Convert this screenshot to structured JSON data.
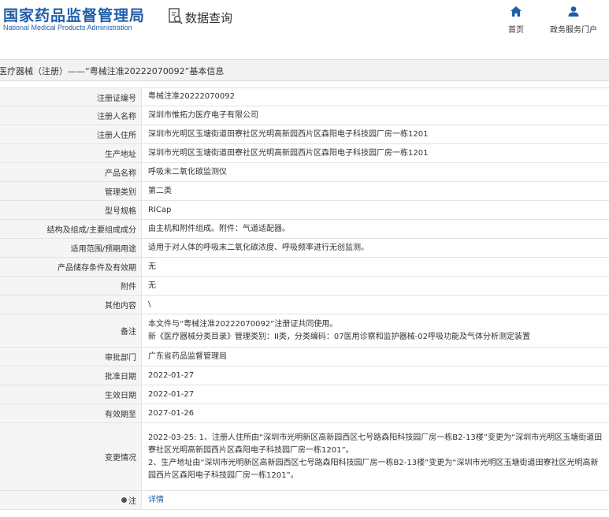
{
  "header": {
    "logo_cn": "国家药品监督管理局",
    "logo_en": "National Medical Products Administration",
    "query_label": "数据查询",
    "nav": {
      "home": "首页",
      "portal": "政务服务门户"
    }
  },
  "title": "医疗器械（注册）——“粤械注准20222070092”基本信息",
  "rows": [
    {
      "label": "注册证编号",
      "value": "粤械注准20222070092"
    },
    {
      "label": "注册人名称",
      "value": "深圳市惟拓力医疗电子有限公司"
    },
    {
      "label": "注册人住所",
      "value": "深圳市光明区玉塘街道田寮社区光明高新园西片区森阳电子科技园厂房一栋1201"
    },
    {
      "label": "生产地址",
      "value": "深圳市光明区玉塘街道田寮社区光明高新园西片区森阳电子科技园厂房一栋1201"
    },
    {
      "label": "产品名称",
      "value": "呼吸末二氧化碳监测仪"
    },
    {
      "label": "管理类别",
      "value": "第二类"
    },
    {
      "label": "型号规格",
      "value": "RICap"
    },
    {
      "label": "结构及组成/主要组成成分",
      "value": "由主机和附件组成。附件：气道适配器。"
    },
    {
      "label": "适用范围/预期用途",
      "value": "适用于对人体的呼吸末二氧化碳浓度、呼吸频率进行无创监测。"
    },
    {
      "label": "产品储存条件及有效期",
      "value": "无"
    },
    {
      "label": "附件",
      "value": "无"
    },
    {
      "label": "其他内容",
      "value": "\\"
    },
    {
      "label": "备注",
      "lines": [
        "本文件与“粤械注准20222070092”注册证共同使用。",
        "新《医疗器械分类目录》管理类别：II类，分类编码：07医用诊察和监护器械-02呼吸功能及气体分析测定装置"
      ]
    },
    {
      "label": "审批部门",
      "value": "广东省药品监督管理局"
    },
    {
      "label": "批准日期",
      "value": "2022-01-27"
    },
    {
      "label": "生效日期",
      "value": "2022-01-27"
    },
    {
      "label": "有效期至",
      "value": "2027-01-26"
    },
    {
      "label": "变更情况",
      "lines": [
        "2022-03-25: 1、注册人住所由“深圳市光明新区高新园西区七号路森阳科技园厂房一栋B2-13楼”变更为“深圳市光明区玉塘街道田",
        "寮社区光明高新园西片区森阳电子科技园厂房一栋1201”。",
        "2、生产地址由“深圳市光明新区高新园西区七号路森阳科技园厂房一栋B2-13楼”变更为“深圳市光明区玉塘街道田寮社区光明高新",
        "园西片区森阳电子科技园厂房一栋1201”。"
      ]
    },
    {
      "label": "注",
      "value": "详情"
    }
  ],
  "colors": {
    "brand": "#1f5ea8",
    "label_bg": "#f5f5f5",
    "title_bg": "#f2f2f2"
  }
}
